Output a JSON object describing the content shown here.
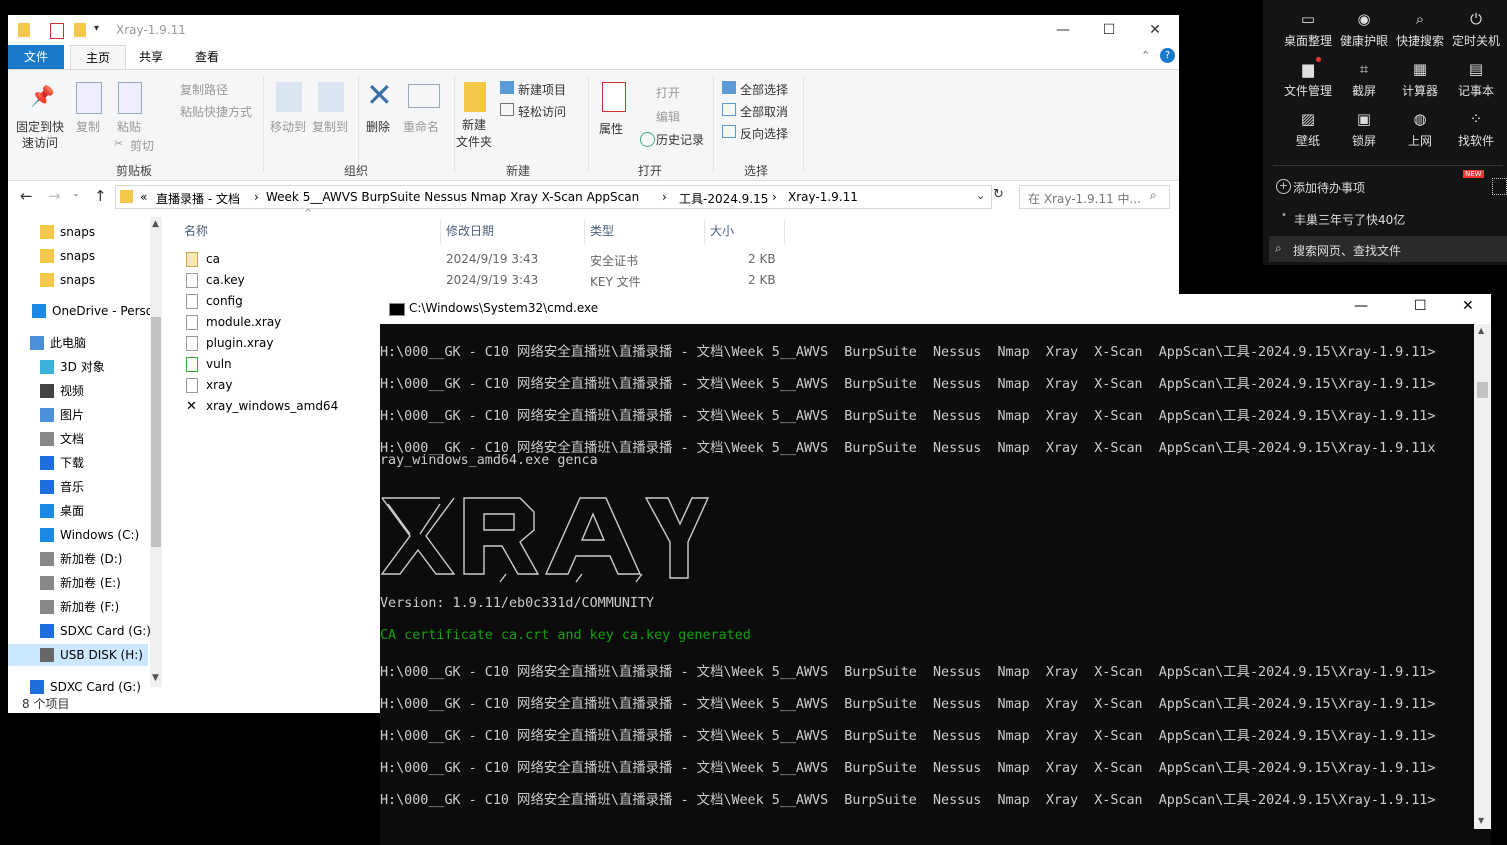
{
  "explorer": {
    "title": "Xray-1.9.11",
    "tabs": [
      "文件",
      "主页",
      "共享",
      "查看"
    ],
    "ribbon": {
      "clipboard": {
        "pin": "固定到快\n速访问",
        "pin_l1": "固定到快",
        "pin_l2": "速访问",
        "copy": "复制",
        "paste": "粘贴",
        "copy_path": "复制路径",
        "paste_shortcut": "粘贴快捷方式",
        "cut": "剪切",
        "label": "剪贴板"
      },
      "organize": {
        "move_to": "移动到",
        "copy_to": "复制到",
        "delete": "删除",
        "rename": "重命名",
        "label": "组织"
      },
      "new": {
        "new_folder_l1": "新建",
        "new_folder_l2": "文件夹",
        "new_item": "新建项目",
        "easy_access": "轻松访问",
        "label": "新建"
      },
      "open": {
        "properties": "属性",
        "open": "打开",
        "edit": "编辑",
        "history": "历史记录",
        "label": "打开"
      },
      "select": {
        "select_all": "全部选择",
        "select_none": "全部取消",
        "invert": "反向选择",
        "label": "选择"
      }
    },
    "breadcrumb": [
      "«",
      "直播录播 - 文档",
      "Week 5__AWVS  BurpSuite  Nessus  Nmap  Xray  X-Scan  AppScan",
      "工具-2024.9.15",
      "Xray-1.9.11"
    ],
    "search_placeholder": "在 Xray-1.9.11 中...",
    "nav": [
      {
        "label": "snaps"
      },
      {
        "label": "snaps"
      },
      {
        "label": "snaps"
      },
      {
        "label": "OneDrive - Perso"
      },
      {
        "label": "此电脑"
      },
      {
        "label": "3D 对象"
      },
      {
        "label": "视频"
      },
      {
        "label": "图片"
      },
      {
        "label": "文档"
      },
      {
        "label": "下载"
      },
      {
        "label": "音乐"
      },
      {
        "label": "桌面"
      },
      {
        "label": "Windows (C:)"
      },
      {
        "label": "新加卷 (D:)"
      },
      {
        "label": "新加卷 (E:)"
      },
      {
        "label": "新加卷 (F:)"
      },
      {
        "label": "SDXC Card (G:)"
      },
      {
        "label": "USB DISK (H:)"
      },
      {
        "label": "SDXC Card (G:)"
      }
    ],
    "columns": [
      "名称",
      "修改日期",
      "类型",
      "大小"
    ],
    "files": [
      {
        "name": "ca",
        "date": "2024/9/19 3:43",
        "type": "安全证书",
        "size": "2 KB"
      },
      {
        "name": "ca.key",
        "date": "2024/9/19 3:43",
        "type": "KEY 文件",
        "size": "2 KB"
      },
      {
        "name": "config",
        "date": "",
        "type": "",
        "size": ""
      },
      {
        "name": "module.xray",
        "date": "",
        "type": "",
        "size": ""
      },
      {
        "name": "plugin.xray",
        "date": "",
        "type": "",
        "size": ""
      },
      {
        "name": "vuln",
        "date": "",
        "type": "",
        "size": ""
      },
      {
        "name": "xray",
        "date": "",
        "type": "",
        "size": ""
      },
      {
        "name": "xray_windows_amd64",
        "date": "",
        "type": "",
        "size": ""
      }
    ],
    "status": "8 个项目"
  },
  "cmd": {
    "title": "C:\\Windows\\System32\\cmd.exe",
    "prompt": "H:\\000__GK - C10 网络安全直播班\\直播录播 - 文档\\Week 5__AWVS  BurpSuite  Nessus  Nmap  Xray  X-Scan  AppScan\\工具-2024.9.15\\Xray-1.9.11>",
    "prompt_cmd_l1": "H:\\000__GK - C10 网络安全直播班\\直播录播 - 文档\\Week 5__AWVS  BurpSuite  Nessus  Nmap  Xray  X-Scan  AppScan\\工具-2024.9.15\\Xray-1.9.11x",
    "prompt_cmd_l2": "ray_windows_amd64.exe genca",
    "version": "Version: 1.9.11/eb0c331d/COMMUNITY",
    "generated": "CA certificate ca.crt and key ca.key generated"
  },
  "panel": {
    "row1": [
      "桌面整理",
      "健康护眼",
      "快捷搜索",
      "定时关机"
    ],
    "row2": [
      "文件管理",
      "截屏",
      "计算器",
      "记事本"
    ],
    "row3": [
      "壁纸",
      "锁屏",
      "上网",
      "找软件"
    ],
    "todo": "添加待办事项",
    "news": "丰巢三年亏了快40亿",
    "search": "搜索网页、查找文件",
    "new_badge": "NEW"
  }
}
